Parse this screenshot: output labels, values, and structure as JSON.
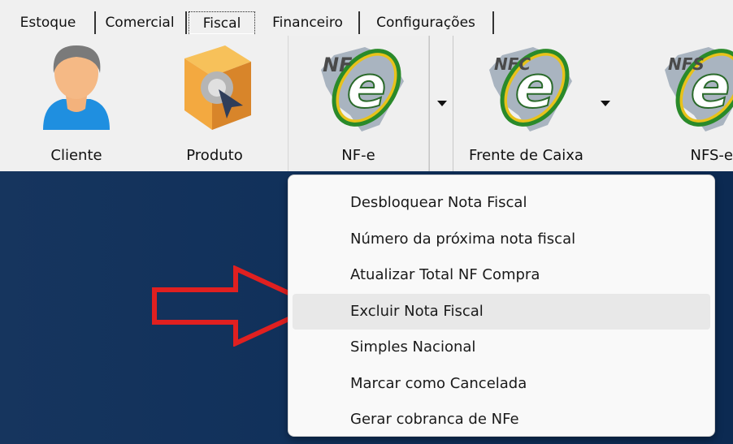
{
  "tabs": [
    {
      "label": "Estoque",
      "active": false
    },
    {
      "label": "Comercial",
      "active": false
    },
    {
      "label": "Fiscal",
      "active": true
    },
    {
      "label": "Financeiro",
      "active": false
    },
    {
      "label": "Configurações",
      "active": false
    }
  ],
  "toolbar": {
    "cliente": {
      "label": "Cliente",
      "icon": "user-icon"
    },
    "produto": {
      "label": "Produto",
      "icon": "product-box-icon"
    },
    "nfe": {
      "label": "NF-e",
      "icon": "nfe-icon",
      "badge": "NF",
      "letter": "e"
    },
    "frente_caixa": {
      "label": "Frente de Caixa",
      "icon": "nfce-icon",
      "badge": "NFC",
      "letter": "e"
    },
    "nfse": {
      "label": "NFS-e",
      "icon": "nfse-icon",
      "badge": "NFS",
      "letter": "e"
    }
  },
  "menu": {
    "items": [
      {
        "label": "Desbloquear Nota Fiscal",
        "hover": false
      },
      {
        "label": "Número da próxima nota fiscal",
        "hover": false
      },
      {
        "label": "Atualizar Total NF Compra",
        "hover": false
      },
      {
        "label": "Excluir Nota Fiscal",
        "hover": true
      },
      {
        "label": "Simples Nacional",
        "hover": false
      },
      {
        "label": "Marcar como Cancelada",
        "hover": false
      },
      {
        "label": "Gerar cobranca de NFe",
        "hover": false
      }
    ]
  },
  "colors": {
    "background": "#10305a",
    "arrow": "#e02020",
    "menu_hover": "#e8e8e8",
    "nfe_green": "#2a8a2a",
    "nfe_yellow": "#e8c21a",
    "user_shirt": "#1f8fe0",
    "box_orange": "#f0a030"
  }
}
